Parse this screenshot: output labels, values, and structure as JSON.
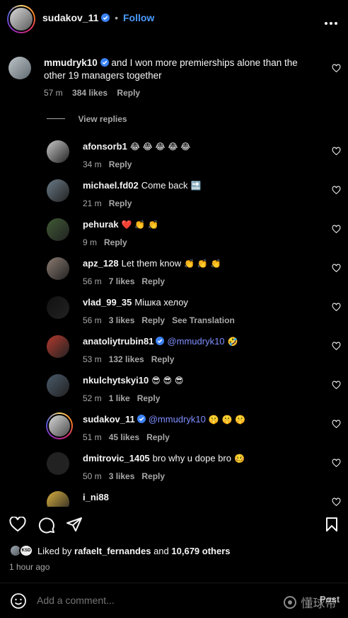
{
  "header": {
    "username": "sudakov_11",
    "dot": "•",
    "follow_label": "Follow"
  },
  "main_comment": {
    "username": "mmudryk10",
    "text_line1": "and I won more premierships alone than the",
    "text_line2": "other 19 managers together",
    "time": "57 m",
    "likes": "384 likes",
    "reply": "Reply"
  },
  "view_replies": "View replies",
  "replies": [
    {
      "username": "afonsorb1",
      "text": "",
      "emoji": "😂 😂 😂 😂 😂",
      "time": "34 m",
      "likes": "",
      "reply": "Reply",
      "translate": "",
      "avatar_color": "#c8c8c8"
    },
    {
      "username": "michael.fd02",
      "text": "Come back",
      "emoji": "🔜",
      "time": "21 m",
      "likes": "",
      "reply": "Reply",
      "translate": "",
      "avatar_color": "#6a7a86"
    },
    {
      "username": "pehurak",
      "text": "",
      "emoji": "❤️ 👏 👏",
      "time": "9 m",
      "likes": "",
      "reply": "Reply",
      "translate": "",
      "avatar_color": "#3f5a34"
    },
    {
      "username": "apz_128",
      "text": "Let them know",
      "emoji": "👏 👏 👏",
      "time": "56 m",
      "likes": "7 likes",
      "reply": "Reply",
      "translate": "",
      "avatar_color": "#8a7a70"
    },
    {
      "username": "vlad_99_35",
      "text": "Мішка хелоу",
      "emoji": "",
      "time": "56 m",
      "likes": "3 likes",
      "reply": "Reply",
      "translate": "See Translation",
      "avatar_color": "#111111"
    },
    {
      "username": "anatoliytrubin81",
      "text": "",
      "mention": "@mmudryk10",
      "emoji": "🤣",
      "time": "53 m",
      "likes": "132 likes",
      "reply": "Reply",
      "translate": "",
      "avatar_color": "#b33a2e",
      "verified": true
    },
    {
      "username": "nkulchytskyi10",
      "text": "",
      "emoji": "😎 😎 😎",
      "time": "52 m",
      "likes": "1 like",
      "reply": "Reply",
      "translate": "",
      "avatar_color": "#4a5a6a"
    },
    {
      "username": "sudakov_11",
      "text": "",
      "mention": "@mmudryk10",
      "emoji": "🤫 🤫 🤫",
      "time": "51 m",
      "likes": "45 likes",
      "reply": "Reply",
      "translate": "",
      "avatar_color": "#cccccc",
      "verified": true,
      "ring": true
    },
    {
      "username": "dmitrovic_1405",
      "text": "bro why u dope bro",
      "emoji": "🥴",
      "time": "50 m",
      "likes": "3 likes",
      "reply": "Reply",
      "translate": "",
      "avatar_color": "#222222"
    },
    {
      "username": "i_ni88",
      "text": "",
      "emoji": "",
      "time": "",
      "likes": "",
      "reply": "",
      "translate": "",
      "avatar_color": "#d8b040"
    }
  ],
  "actions": {
    "liked_by_prefix": "Liked by",
    "liked_by_user": "rafaelt_fernandes",
    "liked_by_and": "and",
    "liked_by_others": "10,679 others",
    "time_ago": "1 hour ago",
    "avatar_badge": "KSD"
  },
  "comment_box": {
    "placeholder": "Add a comment...",
    "post_label": "Post",
    "watermark": "懂球帝"
  }
}
